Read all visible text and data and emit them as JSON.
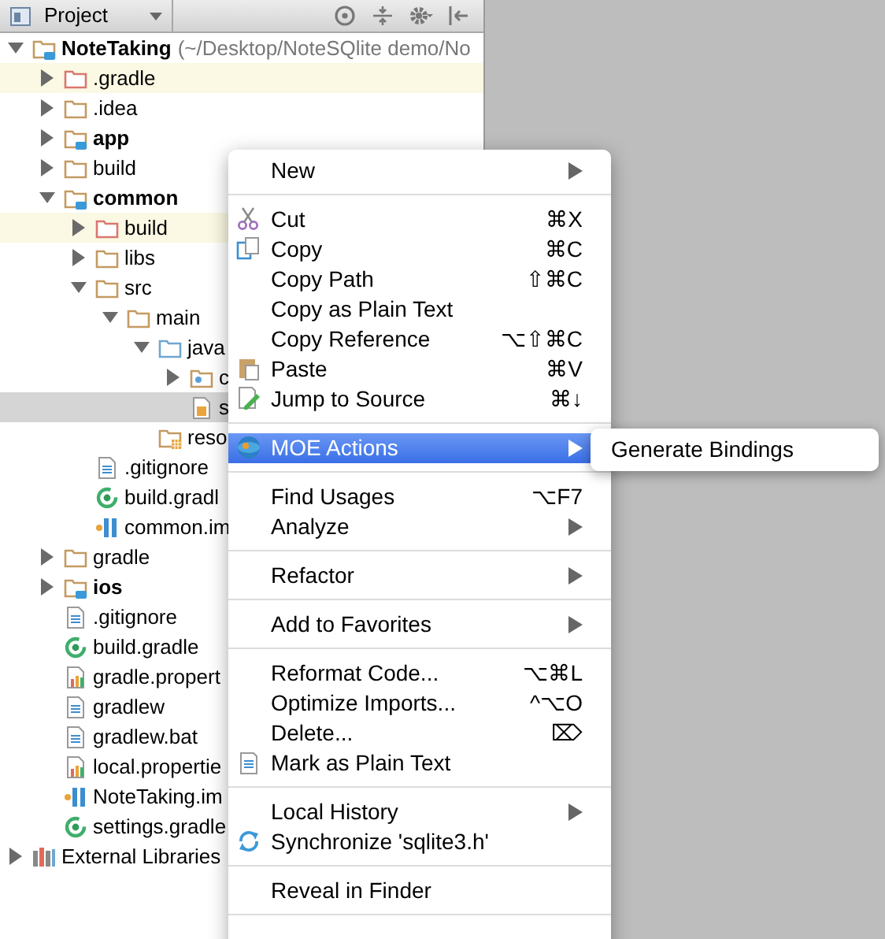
{
  "panel": {
    "view": "Project"
  },
  "tree": [
    {
      "label": "NoteTaking",
      "note": "(~/Desktop/NoteSQlite demo/No",
      "kind": "module",
      "expanded": true,
      "selected": false,
      "excluded": false,
      "children": [
        {
          "label": ".gradle",
          "kind": "folder",
          "expanded": false,
          "selected": false,
          "excluded": true
        },
        {
          "label": ".idea",
          "kind": "folder",
          "expanded": false,
          "selected": false,
          "excluded": false
        },
        {
          "label": "app",
          "kind": "module",
          "expanded": false,
          "selected": false,
          "excluded": false
        },
        {
          "label": "build",
          "kind": "folder",
          "expanded": false,
          "selected": false,
          "excluded": false
        },
        {
          "label": "common",
          "kind": "module",
          "expanded": true,
          "selected": false,
          "excluded": false,
          "children": [
            {
              "label": "build",
              "kind": "folder",
              "expanded": false,
              "selected": false,
              "excluded": true
            },
            {
              "label": "libs",
              "kind": "folder",
              "expanded": false,
              "selected": false,
              "excluded": false
            },
            {
              "label": "src",
              "kind": "folder",
              "expanded": true,
              "selected": false,
              "excluded": false,
              "children": [
                {
                  "label": "main",
                  "kind": "folder",
                  "expanded": true,
                  "selected": false,
                  "excluded": false,
                  "children": [
                    {
                      "label": "java",
                      "kind": "source",
                      "expanded": true,
                      "selected": false,
                      "excluded": false,
                      "children": [
                        {
                          "label": "c",
                          "kind": "package",
                          "expanded": false,
                          "selected": false,
                          "excluded": false
                        },
                        {
                          "label": "s",
                          "kind": "header",
                          "selected": true,
                          "excluded": false
                        }
                      ]
                    },
                    {
                      "label": "reso",
                      "kind": "resources",
                      "selected": false,
                      "excluded": false
                    }
                  ]
                }
              ]
            },
            {
              "label": ".gitignore",
              "kind": "text",
              "selected": false,
              "excluded": false
            },
            {
              "label": "build.gradl",
              "kind": "gradle",
              "selected": false,
              "excluded": false
            },
            {
              "label": "common.im",
              "kind": "iml",
              "selected": false,
              "excluded": false
            }
          ]
        },
        {
          "label": "gradle",
          "kind": "folder",
          "expanded": false,
          "selected": false,
          "excluded": false
        },
        {
          "label": "ios",
          "kind": "module",
          "expanded": false,
          "selected": false,
          "excluded": false
        },
        {
          "label": ".gitignore",
          "kind": "text",
          "selected": false,
          "excluded": false
        },
        {
          "label": "build.gradle",
          "kind": "gradle",
          "selected": false,
          "excluded": false
        },
        {
          "label": "gradle.propert",
          "kind": "properties",
          "selected": false,
          "excluded": false
        },
        {
          "label": "gradlew",
          "kind": "text",
          "selected": false,
          "excluded": false
        },
        {
          "label": "gradlew.bat",
          "kind": "text",
          "selected": false,
          "excluded": false
        },
        {
          "label": "local.propertie",
          "kind": "properties",
          "selected": false,
          "excluded": false
        },
        {
          "label": "NoteTaking.im",
          "kind": "iml",
          "selected": false,
          "excluded": false
        },
        {
          "label": "settings.gradle",
          "kind": "gradle",
          "selected": false,
          "excluded": false
        }
      ]
    },
    {
      "label": "External Libraries",
      "kind": "libraries",
      "expanded": false,
      "selected": false,
      "excluded": false
    }
  ],
  "context_menu": [
    [
      {
        "label": "New",
        "has_submenu": true,
        "selected": false
      }
    ],
    [
      {
        "label": "Cut",
        "kind": "cut",
        "shortcut": "⌘X",
        "selected": false
      },
      {
        "label": "Copy",
        "kind": "copy",
        "shortcut": "⌘C",
        "selected": false
      },
      {
        "label": "Copy Path",
        "shortcut": "⇧⌘C",
        "selected": false
      },
      {
        "label": "Copy as Plain Text",
        "selected": false
      },
      {
        "label": "Copy Reference",
        "shortcut": "⌥⇧⌘C",
        "selected": false
      },
      {
        "label": "Paste",
        "kind": "paste",
        "shortcut": "⌘V",
        "selected": false
      },
      {
        "label": "Jump to Source",
        "kind": "jump",
        "shortcut": "⌘↓",
        "selected": false
      }
    ],
    [
      {
        "label": "MOE Actions",
        "kind": "moe",
        "has_submenu": true,
        "selected": true,
        "submenu": [
          {
            "label": "Generate Bindings",
            "selected": false
          }
        ]
      }
    ],
    [
      {
        "label": "Find Usages",
        "shortcut": "⌥F7",
        "selected": false
      },
      {
        "label": "Analyze",
        "has_submenu": true,
        "selected": false
      }
    ],
    [
      {
        "label": "Refactor",
        "has_submenu": true,
        "selected": false
      }
    ],
    [
      {
        "label": "Add to Favorites",
        "has_submenu": true,
        "selected": false
      }
    ],
    [
      {
        "label": "Reformat Code...",
        "shortcut": "⌥⌘L",
        "selected": false
      },
      {
        "label": "Optimize Imports...",
        "shortcut": "^⌥O",
        "selected": false
      },
      {
        "label": "Delete...",
        "shortcut": "⌦",
        "selected": false
      },
      {
        "label": "Mark as Plain Text",
        "kind": "plain",
        "selected": false
      }
    ],
    [
      {
        "label": "Local History",
        "has_submenu": true,
        "selected": false
      },
      {
        "label": "Synchronize 'sqlite3.h'",
        "kind": "sync",
        "selected": false
      }
    ],
    [
      {
        "label": "Reveal in Finder",
        "selected": false
      }
    ]
  ]
}
